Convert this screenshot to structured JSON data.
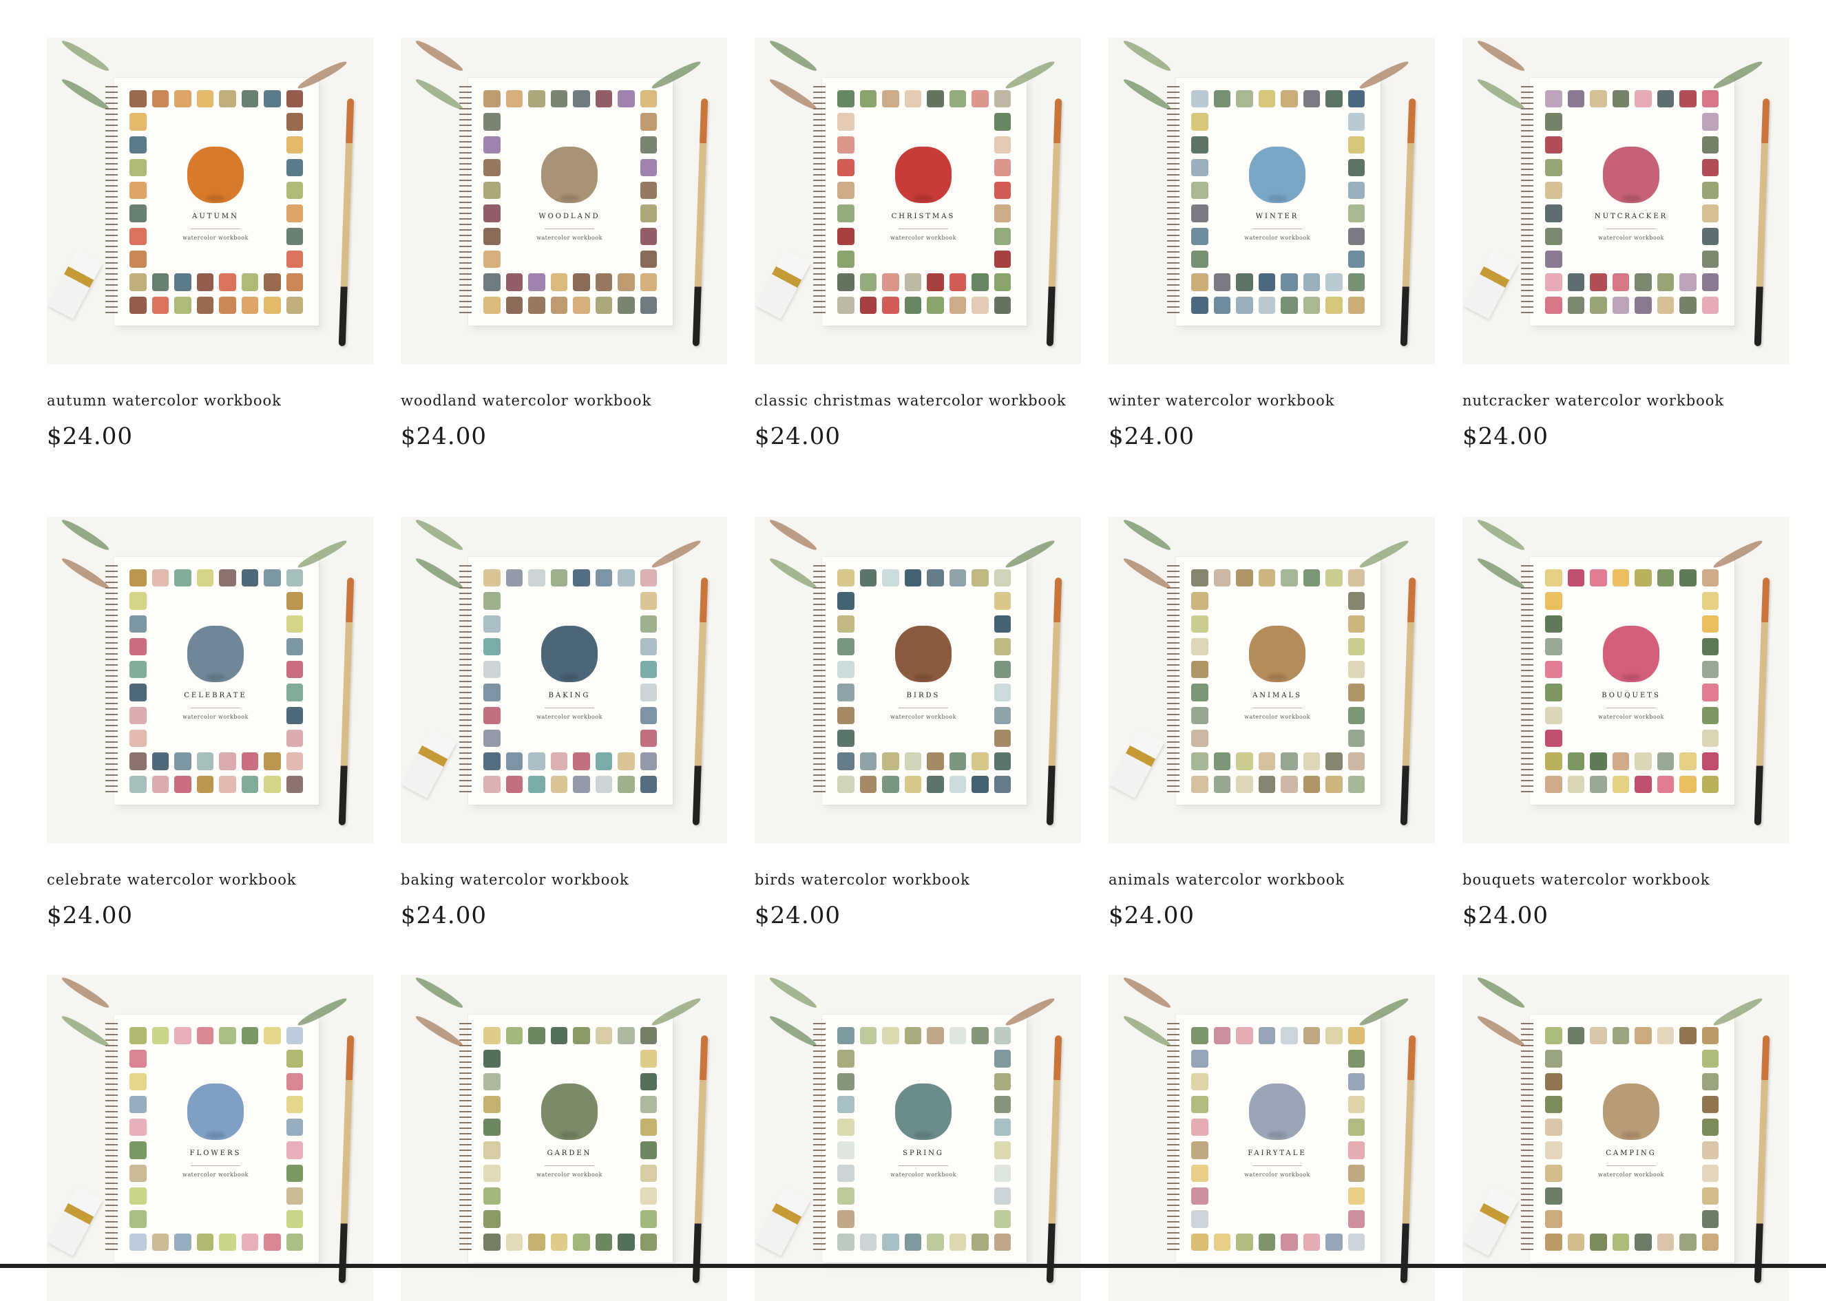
{
  "products": [
    {
      "title": "autumn watercolor workbook",
      "price": "$24.00",
      "cover_title": "AUTUMN",
      "cover_subtitle": "watercolor workbook",
      "icon": "pumpkin-icon",
      "accent": "#d97a2b",
      "palette": [
        "#8d5b3c",
        "#c57a42",
        "#d99a57",
        "#e0b35b",
        "#b9a66e",
        "#597260",
        "#496d7b",
        "#8a4b3d",
        "#d6634c",
        "#a4b269"
      ]
    },
    {
      "title": "woodland watercolor workbook",
      "price": "$24.00",
      "cover_title": "WOODLAND",
      "cover_subtitle": "watercolor workbook",
      "icon": "bear-icon",
      "accent": "#a89376",
      "palette": [
        "#8d6a4e",
        "#b89063",
        "#d2a66e",
        "#a49e6a",
        "#6c7862",
        "#5e6d72",
        "#884d55",
        "#9475a6",
        "#d7b26f",
        "#7e5a47"
      ]
    },
    {
      "title": "classic christmas watercolor workbook",
      "price": "$24.00",
      "cover_title": "CHRISTMAS",
      "cover_subtitle": "watercolor workbook",
      "icon": "truck-icon",
      "accent": "#c73b38",
      "palette": [
        "#9f2b2b",
        "#cd4b42",
        "#557a50",
        "#7d9b5c",
        "#c8a27b",
        "#e1c5ad",
        "#53654d",
        "#8aa371",
        "#d88b7f",
        "#b8b09b"
      ]
    },
    {
      "title": "winter watercolor workbook",
      "price": "$24.00",
      "cover_title": "WINTER",
      "cover_subtitle": "watercolor workbook",
      "icon": "snow-globe-icon",
      "accent": "#7ba7c7",
      "palette": [
        "#375a73",
        "#5d8094",
        "#8ea9b8",
        "#b1c4ce",
        "#688566",
        "#9fb185",
        "#d2c16b",
        "#c5a46a",
        "#706c75",
        "#4d6554"
      ]
    },
    {
      "title": "nutcracker watercolor workbook",
      "price": "$24.00",
      "cover_title": "NUTCRACKER",
      "cover_subtitle": "watercolor workbook",
      "icon": "dancer-icon",
      "accent": "#c66276",
      "palette": [
        "#a83b45",
        "#d36878",
        "#6b7b61",
        "#8f9b67",
        "#b49ab2",
        "#7e6a86",
        "#d1b98a",
        "#67735a",
        "#e4a2ad",
        "#4c5d61"
      ]
    },
    {
      "title": "celebrate watercolor workbook",
      "price": "$24.00",
      "cover_title": "CELEBRATE",
      "cover_subtitle": "watercolor workbook",
      "icon": "cake-icon",
      "accent": "#6f8797",
      "palette": [
        "#3c596a",
        "#6f8b9a",
        "#9cb7b5",
        "#d7a3a6",
        "#c35f72",
        "#b38b3c",
        "#e0b2aa",
        "#72a38e",
        "#d2d07a",
        "#7e655d"
      ]
    },
    {
      "title": "baking watercolor workbook",
      "price": "$24.00",
      "cover_title": "BAKING",
      "cover_subtitle": "watercolor workbook",
      "icon": "mixing-bowl-icon",
      "accent": "#4c6678",
      "palette": [
        "#405e72",
        "#6e889b",
        "#a3b8c1",
        "#d8a8aa",
        "#bd6170",
        "#6ba4a0",
        "#d6bf8b",
        "#888f9d",
        "#c5d0d2",
        "#93a882"
      ]
    },
    {
      "title": "birds watercolor workbook",
      "price": "$24.00",
      "cover_title": "BIRDS",
      "cover_subtitle": "watercolor workbook",
      "icon": "bird-icon",
      "accent": "#8b5b3f",
      "palette": [
        "#2f5264",
        "#536f7b",
        "#829aa0",
        "#b9b176",
        "#c9d0b0",
        "#9b7b53",
        "#6d8c72",
        "#d4c17e",
        "#49665c",
        "#c6d8d9"
      ]
    },
    {
      "title": "animals watercolor workbook",
      "price": "$24.00",
      "cover_title": "ANIMALS",
      "cover_subtitle": "watercolor workbook",
      "icon": "dog-icon",
      "accent": "#b48b5a",
      "palette": [
        "#a78a58",
        "#c6ad70",
        "#9ab08d",
        "#6e8b69",
        "#c6c985",
        "#d2ba95",
        "#8b9e86",
        "#dad2af",
        "#7a775f",
        "#c6b09b"
      ]
    },
    {
      "title": "bouquets watercolor workbook",
      "price": "$24.00",
      "cover_title": "BOUQUETS",
      "cover_subtitle": "watercolor workbook",
      "icon": "bouquet-icon",
      "accent": "#d45f7a",
      "palette": [
        "#b93b5d",
        "#dd6f86",
        "#e7b84f",
        "#b3a94b",
        "#6f8c52",
        "#4d6c45",
        "#caa27d",
        "#d8d1b1",
        "#8da18b",
        "#e3ca74"
      ]
    },
    {
      "title": "",
      "price": "",
      "cover_title": "FLOWERS",
      "cover_subtitle": "watercolor workbook",
      "icon": "hydrangea-icon",
      "accent": "#7f9fc4",
      "palette": [
        "#a6b05e",
        "#c6d17b",
        "#e6a9b2",
        "#d67987",
        "#9fb879",
        "#6d8e53",
        "#e2d37d",
        "#b5c6d7",
        "#c5b28b",
        "#8da4b7"
      ]
    },
    {
      "title": "",
      "price": "",
      "cover_title": "GARDEN",
      "cover_subtitle": "watercolor workbook",
      "icon": "planter-icon",
      "accent": "#7b8a69",
      "palette": [
        "#bfa85e",
        "#dbc67d",
        "#99b06f",
        "#5d7a52",
        "#416148",
        "#7d8f56",
        "#d1c89a",
        "#a3b197",
        "#667055",
        "#e0d6b3"
      ]
    },
    {
      "title": "",
      "price": "",
      "cover_title": "SPRING",
      "cover_subtitle": "watercolor workbook",
      "icon": "bicycle-icon",
      "accent": "#6c8c8b",
      "palette": [
        "#c7cfd1",
        "#9eb8be",
        "#708f94",
        "#b5c491",
        "#d8d6a8",
        "#9da26f",
        "#bb9f7d",
        "#dbe2dc",
        "#788b6b",
        "#b5c7bc"
      ]
    },
    {
      "title": "",
      "price": "",
      "cover_title": "FAIRYTALE",
      "cover_subtitle": "watercolor workbook",
      "icon": "castle-icon",
      "accent": "#9aa5b6",
      "palette": [
        "#d9b564",
        "#e5c97a",
        "#a7b474",
        "#6e8a5a",
        "#c98391",
        "#e0a4a8",
        "#8b9bb0",
        "#c7d0d6",
        "#b8a072",
        "#d9cf9d"
      ]
    },
    {
      "title": "",
      "price": "",
      "cover_title": "CAMPING",
      "cover_subtitle": "watercolor workbook",
      "icon": "backpack-icon",
      "accent": "#b99b76",
      "palette": [
        "#87653e",
        "#b58f58",
        "#cfb680",
        "#6e7e48",
        "#a4b46d",
        "#5c6f57",
        "#d6c1a1",
        "#8f9a71",
        "#c5a16f",
        "#e2d3b6"
      ]
    }
  ]
}
